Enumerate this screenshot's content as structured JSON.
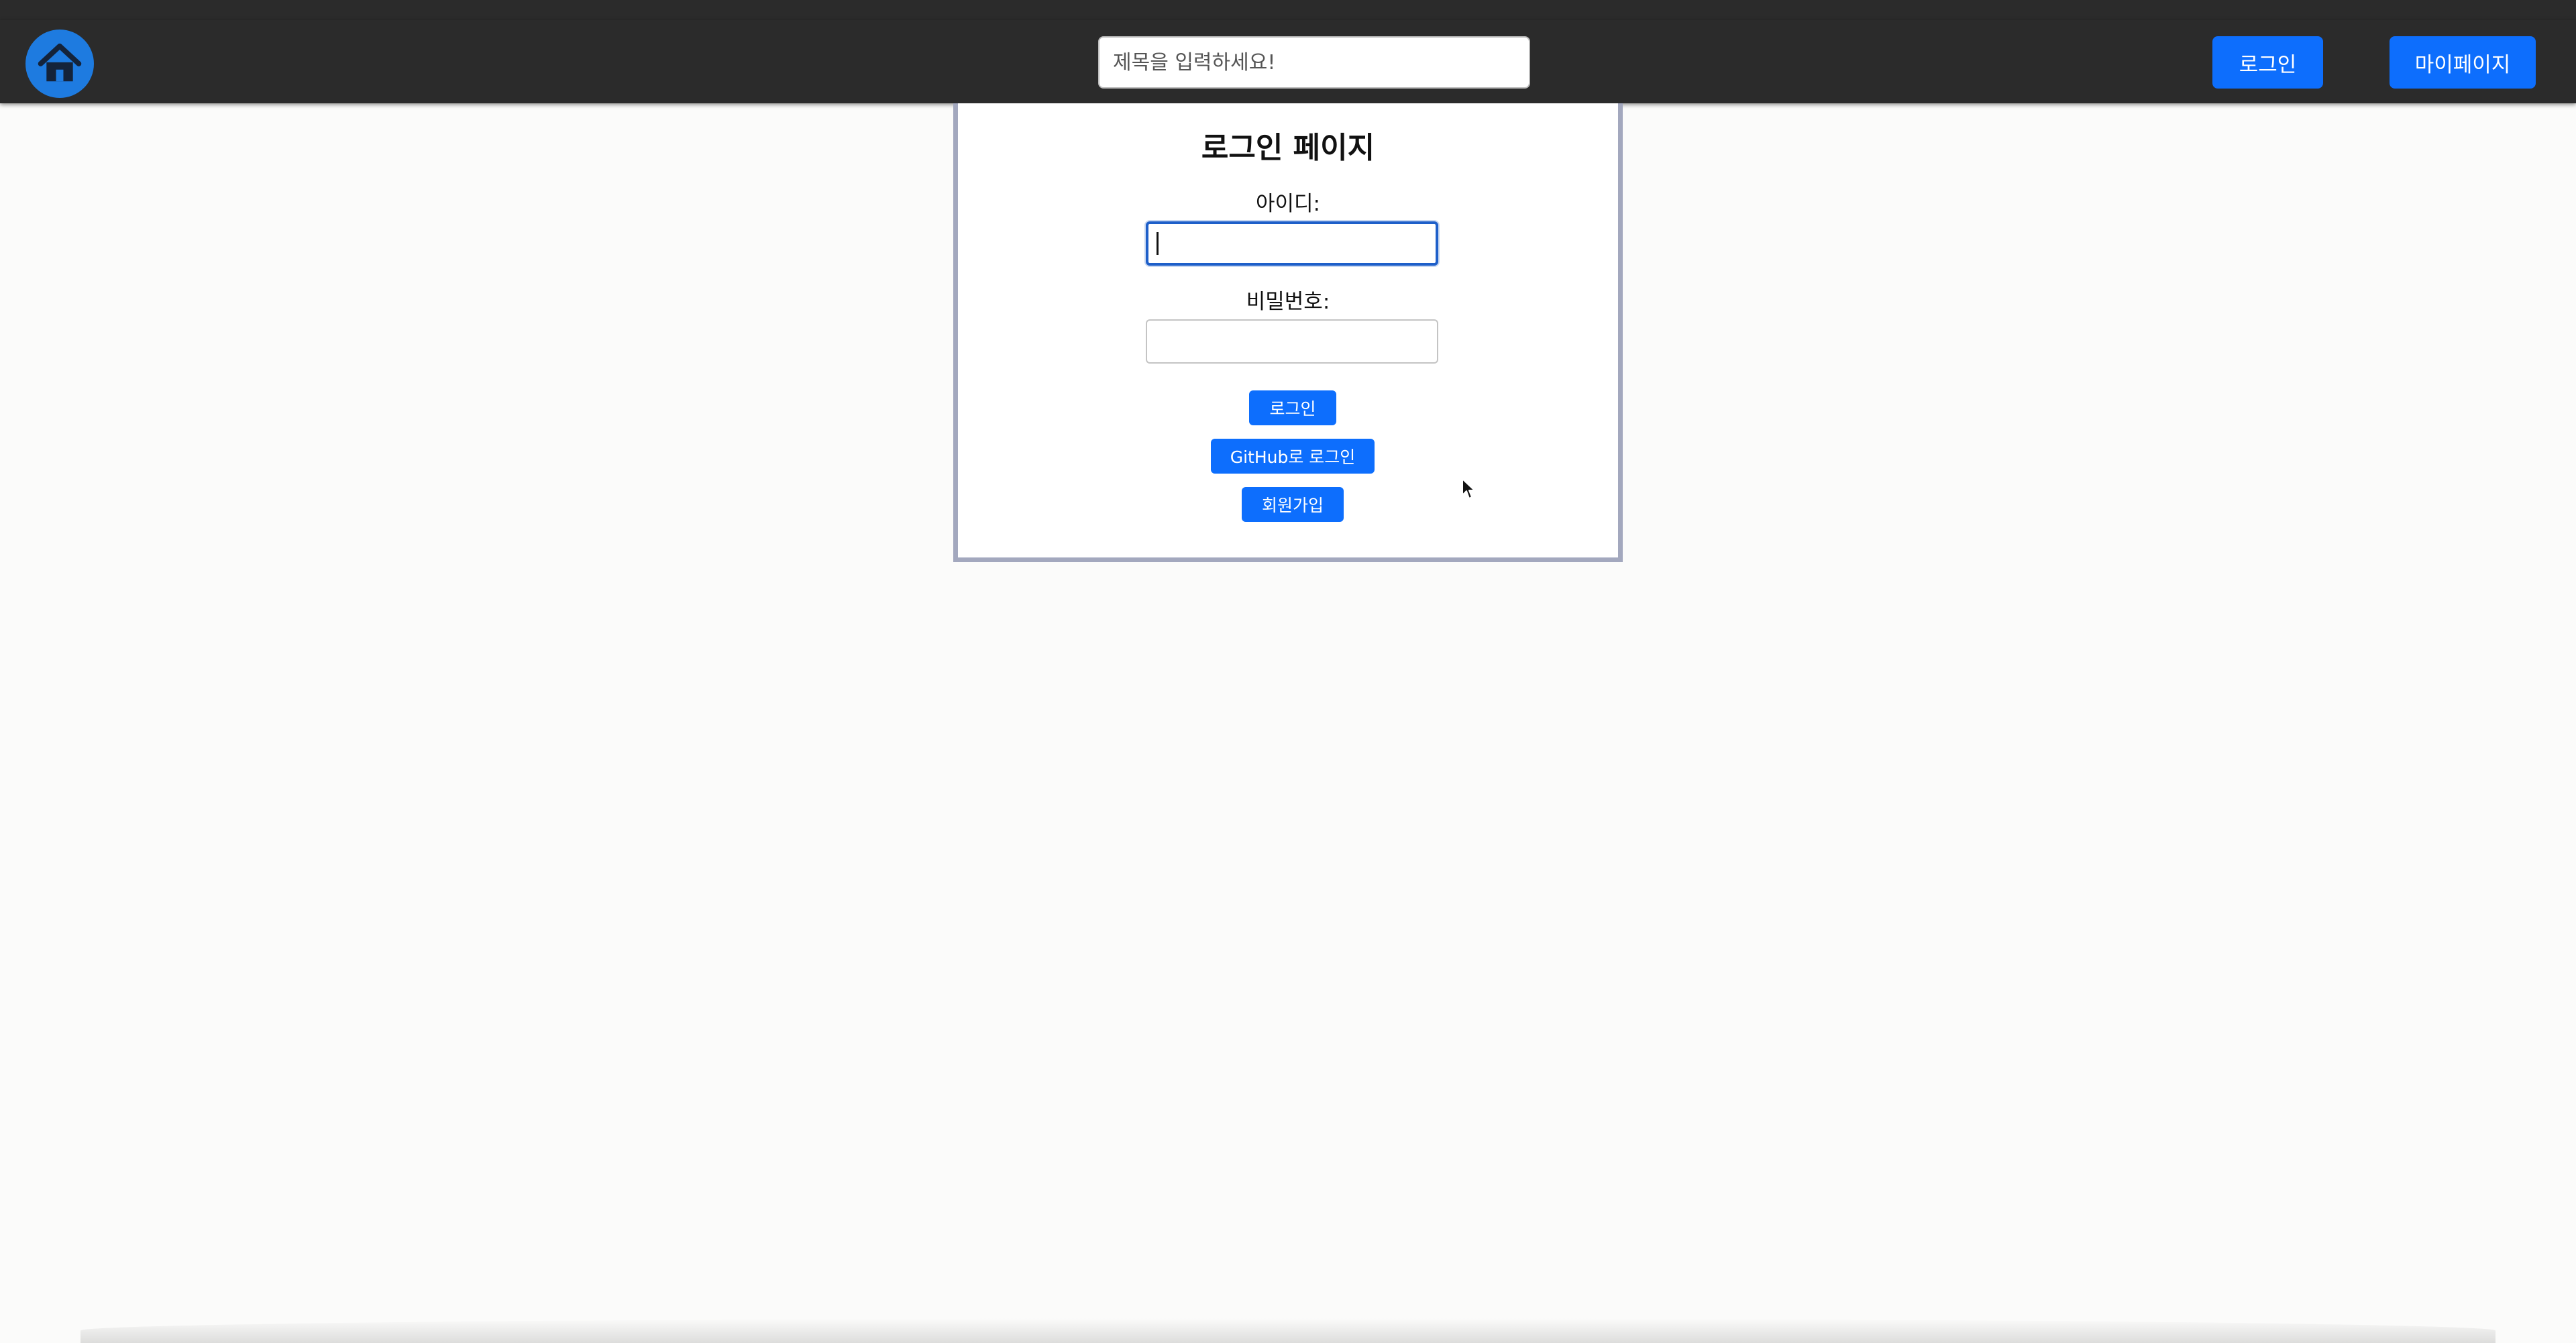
{
  "header": {
    "home_icon": "home-icon",
    "search_placeholder": "제목을 입력하세요!",
    "login_label": "로그인",
    "mypage_label": "마이페이지"
  },
  "login_form": {
    "title": "로그인 페이지",
    "id_label": "아이디:",
    "password_label": "비밀번호:",
    "login_button": "로그인",
    "github_button": "GitHub로 로그인",
    "signup_button": "회원가입"
  },
  "colors": {
    "header_bg": "#2b2b2b",
    "primary": "#0d6efd",
    "home_circle": "#1e7be0",
    "card_border": "#a3a8be",
    "focus_border": "#1e5fc9"
  }
}
